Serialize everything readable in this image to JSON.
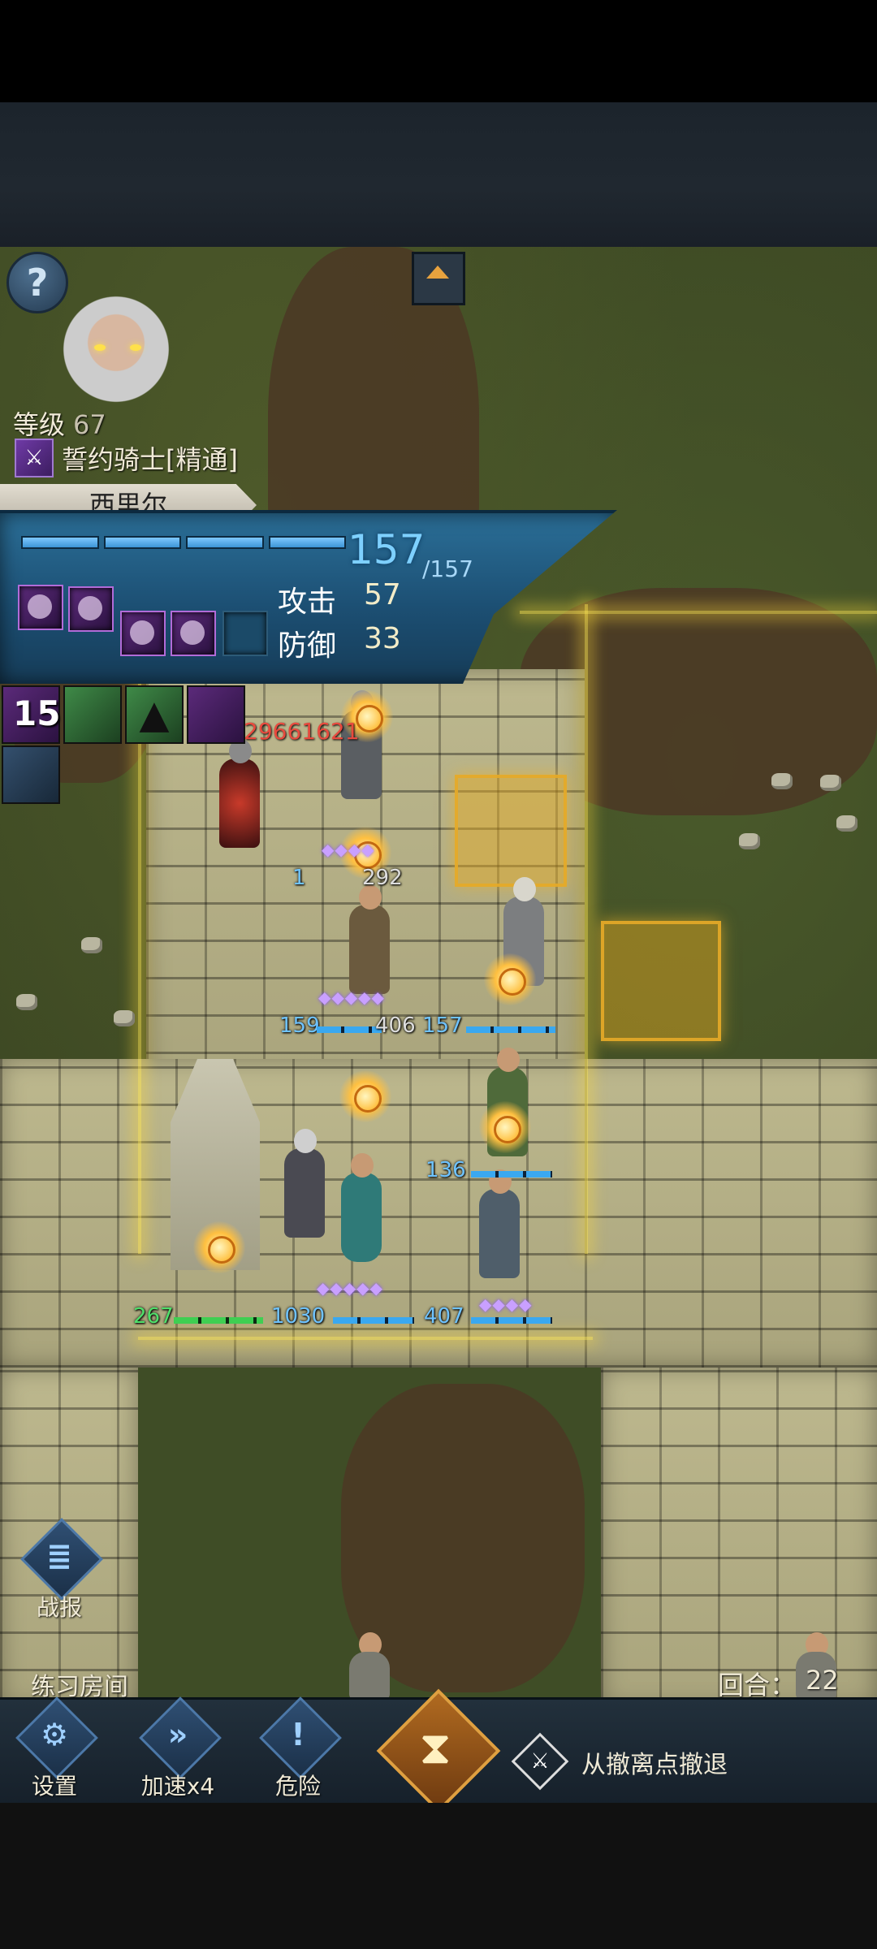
{
  "hero": {
    "level_label": "等级",
    "level_value": "67",
    "class_name": "誓约骑士[精通]",
    "name": "西里尔",
    "hp_current": "157",
    "hp_max": "/157",
    "attack_label": "攻击",
    "attack_value": "57",
    "defense_label": "防御",
    "defense_value": "33"
  },
  "help_glyph": "?",
  "buffs": {
    "count": "15"
  },
  "units": {
    "enemy_damage": "29661621",
    "enemy_hp": "1",
    "enemy_hp2": "292",
    "ally1_hp": "159",
    "ally2_hp": "406",
    "ally3_hp": "157",
    "ally4_hp": "136",
    "ally5_hp": "267",
    "ally6_hp": "1030",
    "ally7_hp": "407"
  },
  "hud": {
    "report_label": "战报",
    "room_label": "练习房间",
    "turn_label": "回合：",
    "turn_value": "22",
    "settings_label": "设置",
    "speed_label": "加速x4",
    "danger_label": "危险",
    "retreat_label": "从撤离点撤退",
    "report_glyph": "≣",
    "settings_glyph": "⚙",
    "speed_glyph": "»",
    "danger_glyph": "!",
    "hourglass_glyph": "⧗",
    "retreat_glyph": "⚔"
  },
  "colors": {
    "panel_blue": "#1c4f73",
    "hp_blue": "#6fc3ff",
    "damage_red": "#e84a3e",
    "highlight_gold": "#e6aa28"
  }
}
